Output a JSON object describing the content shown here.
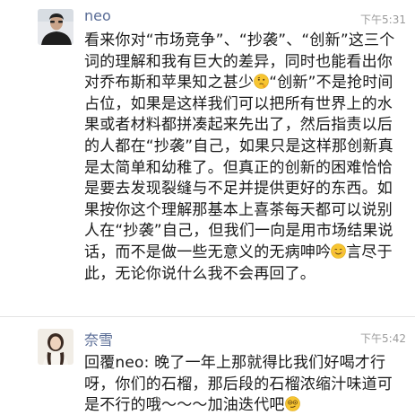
{
  "posts": [
    {
      "author": "neo",
      "time": "下午5:31",
      "text_1": "看来你对“市场竞争”、“抄袭”、“创新”这三个词的理解和我有巨大的差异，同时也能看出你对乔布斯和苹果知之甚少",
      "emoji_1": "thinking-face-icon",
      "text_2": "“创新”不是抢时间占位，如果是这样我们可以把所有世界上的水果或者材料都拼凑起来先出了，然后指责以后的人都在“抄袭”自己，如果只是这样那创新真是太简单和幼稚了。但真正的创新的困难恰恰是要去发现裂缝与不足并提供更好的东西。如果按你这个理解那基本上喜茶每天都可以说别人在“抄袭”自己，但我们一向是用市场结果说话，而不是做一些无意义的无病呻吟",
      "emoji_2": "smiling-face-icon",
      "text_3": "言尽于此，无论你说什么我不会再回了。"
    },
    {
      "author": "奈雪",
      "time": "下午5:42",
      "text_1": "回覆neo: 晚了一年上那就得比我们好喝才行呀，你们的石榴，那后段的石榴浓缩汁味道可是不行的哦～～～加油迭代吧",
      "emoji_1": "smirking-face-icon"
    }
  ],
  "colors": {
    "author": "#586b95",
    "text": "#1a1a1a",
    "time": "#9b9b9b"
  }
}
